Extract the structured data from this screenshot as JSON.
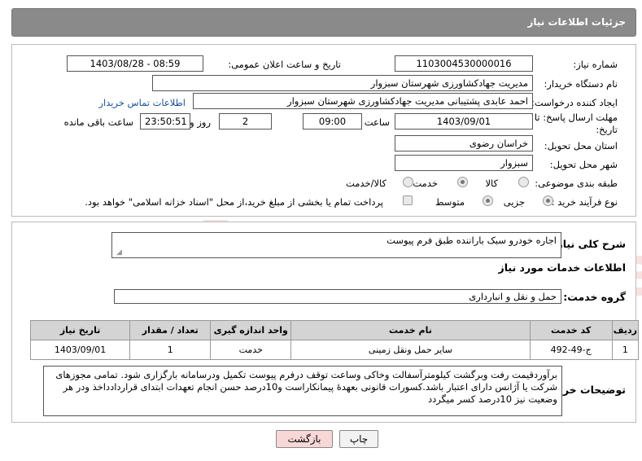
{
  "header": {
    "title": "جزئیات اطلاعات نیاز"
  },
  "form": {
    "need_number_label": "شماره نیاز:",
    "need_number": "1103004530000016",
    "announce_label": "تاریخ و ساعت اعلان عمومی:",
    "announce_value": "1403/08/28 - 08:59",
    "buyer_org_label": "نام دستگاه خریدار:",
    "buyer_org": "مدیریت جهادکشاورزی شهرستان سبزوار",
    "creator_label": "ایجاد کننده درخواست:",
    "creator": "احمد عابدی پشتیبانی مدیریت جهادکشاورزی شهرستان سبزوار",
    "contact_link": "اطلاعات تماس خریدار",
    "deadline_label_1": "مهلت ارسال پاسخ: تا",
    "deadline_label_2": "تاریخ:",
    "deadline_date": "1403/09/01",
    "time_label": "ساعت",
    "deadline_time": "09:00",
    "days_value": "2",
    "days_label": "روز و",
    "remaining_time": "23:50:51",
    "remaining_label": "ساعت باقی مانده",
    "province_label": "استان محل تحویل:",
    "province": "خراسان رضوی",
    "city_label": "شهر محل تحویل:",
    "city": "سبزوار",
    "category_label": "طبقه بندی موضوعی:",
    "category_options": [
      "کالا",
      "خدمت",
      "کالا/خدمت"
    ],
    "category_selected": "خدمت",
    "process_label": "نوع فرآیند خرید :",
    "process_options": [
      "جزیی",
      "متوسط"
    ],
    "process_selected": "جزیی",
    "payment_note": "پرداخت تمام یا بخشی از مبلغ خرید،از محل \"اسناد خزانه اسلامی\" خواهد بود."
  },
  "details": {
    "summary_label": "شرح کلی نیاز:",
    "summary": "اجاره خودرو سبک باراننده  طبق فرم پیوست",
    "services_title": "اطلاعات خدمات مورد نیاز",
    "service_group_label": "گروه خدمت:",
    "service_group": "حمل و نقل و انبارداری",
    "table": {
      "headers": [
        "ردیف",
        "کد خدمت",
        "نام خدمت",
        "واحد اندازه گیری",
        "تعداد / مقدار",
        "تاریخ نیاز"
      ],
      "rows": [
        [
          "1",
          "ج-49-492",
          "سایر حمل ونقل زمینی",
          "خدمت",
          "1",
          "1403/09/01"
        ]
      ]
    },
    "buyer_notes_label": "توضیحات خریدار:",
    "buyer_notes": "برآوردقیمت رفت وبرگشت کیلومترآسفالت وخاکی وساعت توقف درفرم پیوست تکمیل ودرسامانه بارگزاری شود. تمامی مجوزهای شرکت یا آژانس دارای اعتبار باشد.کسورات قانونی بعهدۀ پیمانکاراست و10درصد حسن انجام تعهدات ابتدای قراردادداخذ ودر هر وضعیت نیز 10درصد کسر میگردد"
  },
  "buttons": {
    "print": "چاپ",
    "back": "بازگشت"
  },
  "watermark": {
    "text": "AriaTender.neT"
  },
  "colors": {
    "header_bg": "#8a8a8a",
    "table_header_bg": "#d4d4d4",
    "link": "#1a4f9c",
    "back_button_bg": "#f8d7d7",
    "watermark": "#c41e1e"
  }
}
